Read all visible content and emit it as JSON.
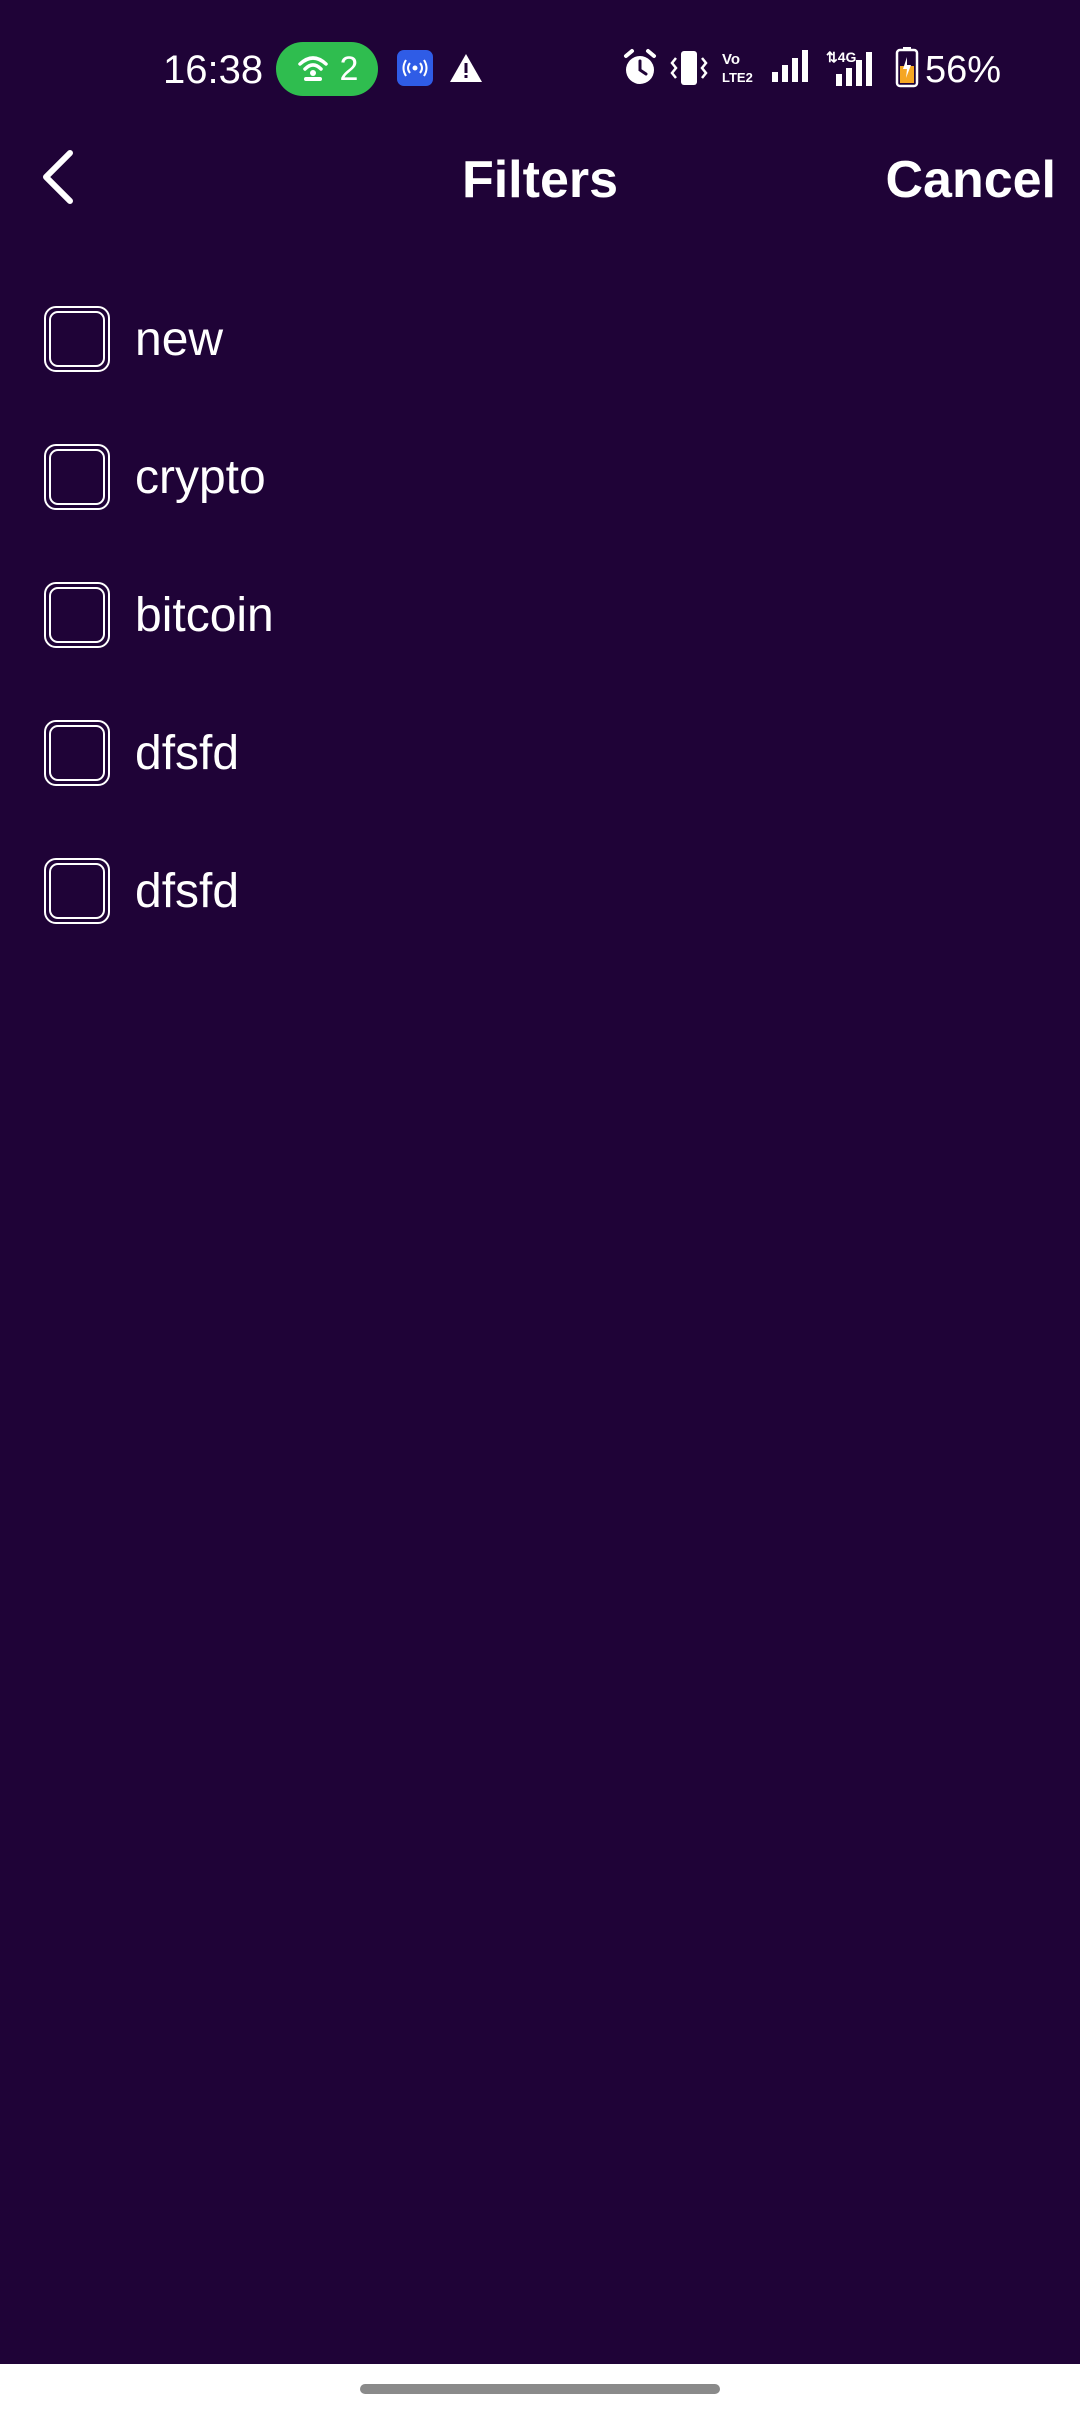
{
  "status_bar": {
    "time": "16:38",
    "hotspot_count": "2",
    "battery_percent": "56%",
    "icons": [
      "hotspot-icon",
      "nfc-icon",
      "warning-icon",
      "alarm-icon",
      "vibrate-icon",
      "volte-icon",
      "signal-icon",
      "signal-4g-icon",
      "battery-icon"
    ],
    "colors": {
      "hotspot_bg": "#2fbd4f",
      "nfc_bg": "#2f5ce6",
      "battery_fill": "#f5a623"
    }
  },
  "header": {
    "title": "Filters",
    "cancel_label": "Cancel",
    "back_icon": "chevron-left-icon"
  },
  "filters": [
    {
      "label": "new",
      "checked": false
    },
    {
      "label": "crypto",
      "checked": false
    },
    {
      "label": "bitcoin",
      "checked": false
    },
    {
      "label": "dfsfd",
      "checked": false
    },
    {
      "label": "dfsfd",
      "checked": false
    }
  ],
  "theme": {
    "background": "#1f0337",
    "text": "#ffffff"
  }
}
